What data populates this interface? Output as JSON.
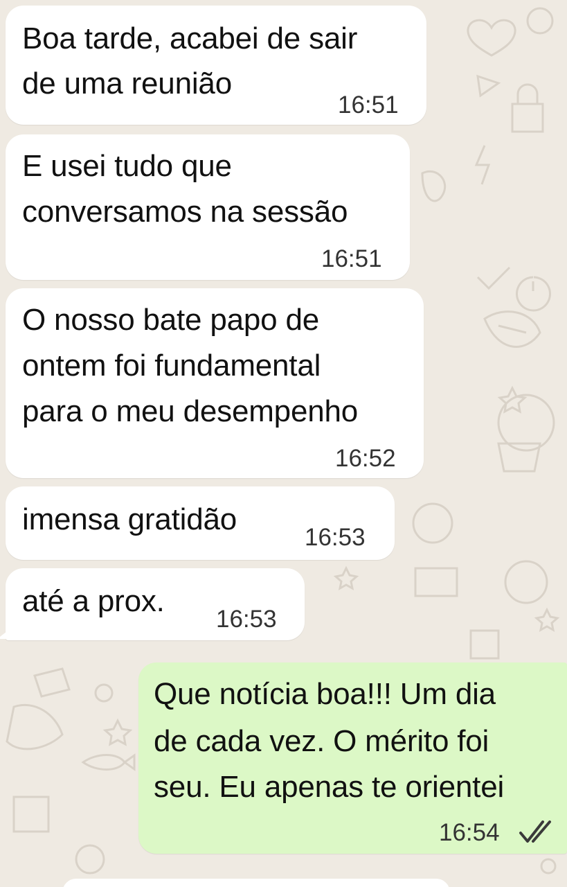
{
  "chat": {
    "background_color": "#efeae2",
    "incoming_bubble_color": "#ffffff",
    "outgoing_bubble_color": "#dcf8c6",
    "messages": [
      {
        "direction": "incoming",
        "lines": [
          "Boa tarde, acabei de sair",
          "de uma reunião"
        ],
        "time": "16:51"
      },
      {
        "direction": "incoming",
        "lines": [
          "E usei tudo que",
          "conversamos na sessão"
        ],
        "time": "16:51"
      },
      {
        "direction": "incoming",
        "lines": [
          "O nosso bate papo de",
          "ontem foi fundamental",
          "para o meu desempenho"
        ],
        "time": "16:52"
      },
      {
        "direction": "incoming",
        "lines": [
          "imensa gratidão"
        ],
        "time": "16:53"
      },
      {
        "direction": "incoming",
        "lines": [
          "até a prox."
        ],
        "time": "16:53"
      },
      {
        "direction": "outgoing",
        "lines": [
          "Que notícia boa!!! Um dia",
          "de cada vez. O mérito foi",
          "seu. Eu apenas te orientei"
        ],
        "time": "16:54",
        "status_icon": "double-check-read-icon"
      }
    ]
  }
}
